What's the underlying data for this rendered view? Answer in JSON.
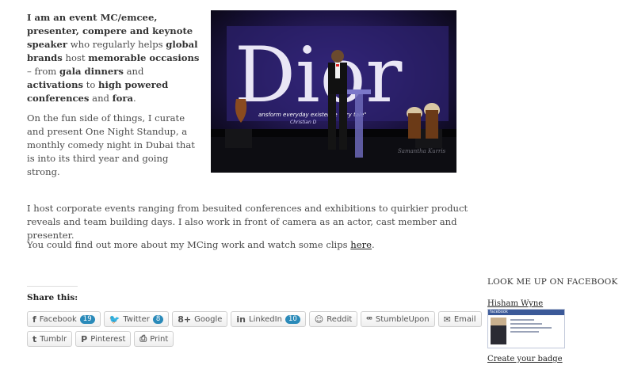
{
  "intro": {
    "p1": {
      "s1": "I am an event MC/emcee, presenter, compere and keynote speaker",
      "s2": " who regularly helps ",
      "s3": "global brands",
      "s4": " host ",
      "s5": "memorable occasions",
      "s6": " – from ",
      "s7": "gala dinners",
      "s8": " and ",
      "s9": "activations",
      "s10": " to ",
      "s11": "high powered conferences",
      "s12": " and ",
      "s13": "fora",
      "s14": "."
    },
    "p2": "On the fun side of things, I curate and present One Night Standup, a monthly comedy night in Dubai that is into its third year and going strong."
  },
  "photo": {
    "brand_text": "Dior",
    "screen_caption": "ansform everyday existence ... ry tale\"",
    "screen_sub": "Christian D",
    "watermark": "Samantha Kurris"
  },
  "body": {
    "para1": "I host corporate events ranging from besuited conferences and exhibitions to quirkier product reveals and team building days. I also work in front of camera as an actor, cast member and presenter.",
    "para2_before": "You could find out more about my MCing work and watch some clips ",
    "para2_link": "here",
    "para2_after": "."
  },
  "share": {
    "title": "Share this:",
    "row1": [
      {
        "icon": "f",
        "label": "Facebook",
        "count": "19"
      },
      {
        "icon": "🐦",
        "label": "Twitter",
        "count": "8"
      },
      {
        "icon": "8+",
        "label": "Google",
        "count": ""
      },
      {
        "icon": "in",
        "label": "LinkedIn",
        "count": "10"
      },
      {
        "icon": "☺",
        "label": "Reddit",
        "count": ""
      },
      {
        "icon": "ꟹ",
        "label": "StumbleUpon",
        "count": ""
      },
      {
        "icon": "✉",
        "label": "Email",
        "count": ""
      }
    ],
    "row2": [
      {
        "icon": "t",
        "label": "Tumblr",
        "count": ""
      },
      {
        "icon": "P",
        "label": "Pinterest",
        "count": ""
      },
      {
        "icon": "⎙",
        "label": "Print",
        "count": ""
      }
    ]
  },
  "facebook": {
    "title": "LOOK ME UP ON FACEBOOK",
    "name": "Hisham Wyne",
    "card_header": "facebook",
    "create": "Create your badge"
  },
  "colors": {
    "facebook_blue": "#3b5998",
    "count_badge": "#2a8ab9"
  }
}
